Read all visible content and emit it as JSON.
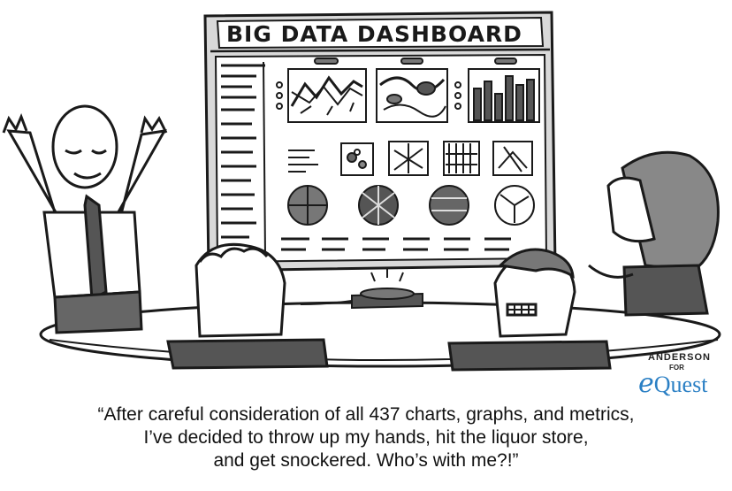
{
  "board": {
    "title": "BIG DATA DASHBOARD"
  },
  "signature": {
    "artist": "ANDERSON",
    "for": "FOR",
    "brand_prefix": "e",
    "brand_rest": "Quest",
    "brand_color": "#2a7fc4"
  },
  "caption": {
    "lines": [
      "“After careful consideration of all 437 charts, graphs, and metrics,",
      "I’ve decided to throw up my hands, hit the liquor store,",
      "and get snockered. Who’s with me?!”"
    ]
  },
  "colors": {
    "ink": "#1a1a1a",
    "board_gray": "#d6d6d6",
    "table": "#ffffff",
    "suit": "#444444",
    "accent_blue": "#2a7fc4"
  }
}
